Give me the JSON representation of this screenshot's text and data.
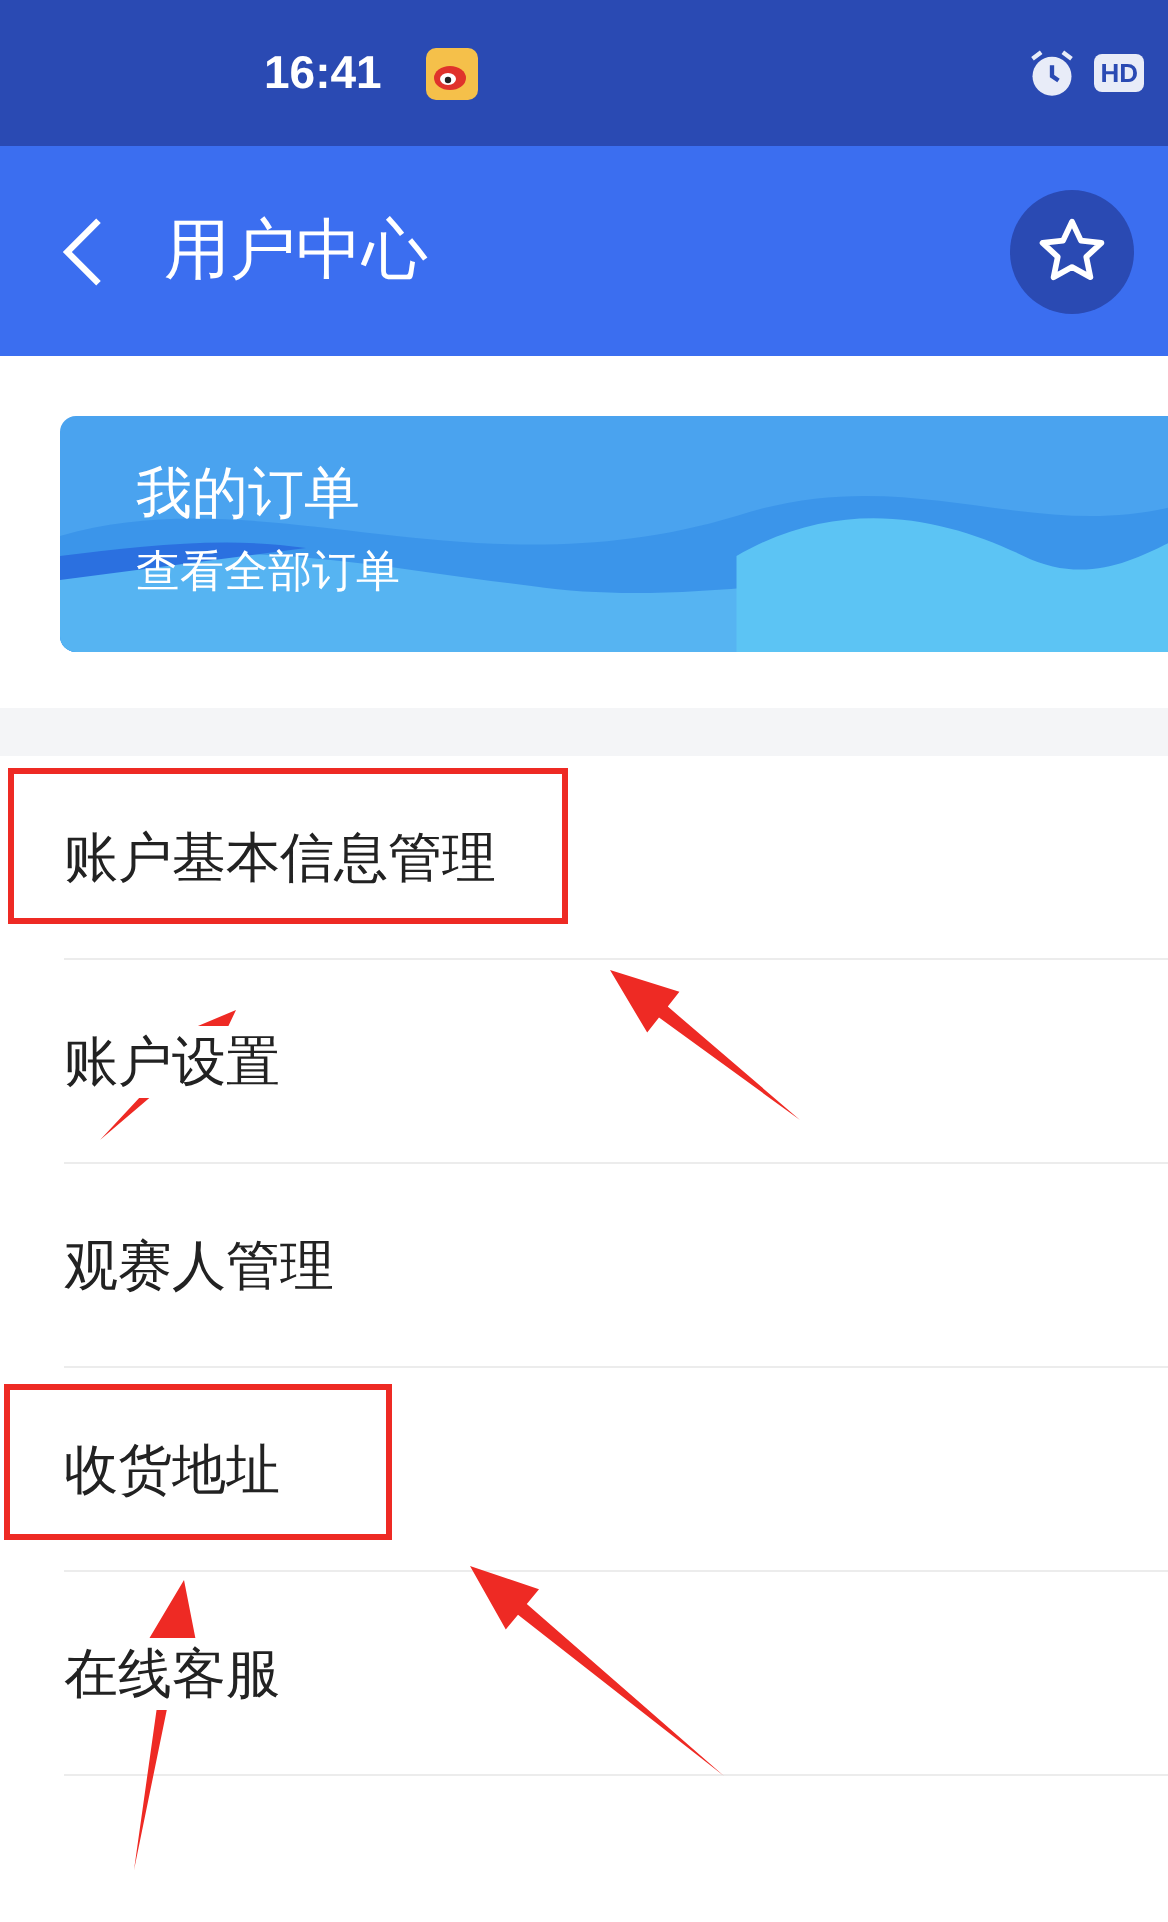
{
  "status_bar": {
    "time": "16:41",
    "badge": "HD"
  },
  "header": {
    "title": "用户中心"
  },
  "order_card": {
    "title": "我的订单",
    "subtitle": "查看全部订单"
  },
  "menu": [
    {
      "label": "账户基本信息管理",
      "highlighted": true
    },
    {
      "label": "账户设置",
      "highlighted": false
    },
    {
      "label": "观赛人管理",
      "highlighted": false
    },
    {
      "label": "收货地址",
      "highlighted": true
    },
    {
      "label": "在线客服",
      "highlighted": false
    }
  ]
}
